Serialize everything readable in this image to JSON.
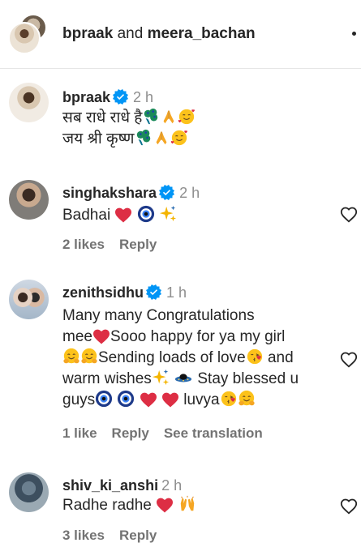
{
  "header": {
    "title_user1": "bpraak",
    "title_and": " and ",
    "title_user2": "meera_bachan"
  },
  "caption": {
    "username": "bpraak",
    "time": "2 h",
    "line1": "सब राधे राधे है",
    "line2": "जय श्री कृष्ण"
  },
  "comments": [
    {
      "username": "singhakshara",
      "time": "2 h",
      "text1": "Badhai",
      "likes": "2 likes",
      "reply": "Reply"
    },
    {
      "username": "zenithsidhu",
      "time": "1 h",
      "text1": "Many many Congratulations",
      "text2a": "mee",
      "text2b": "Sooo happy for ya my girl",
      "text3a": "Sending loads of love",
      "text3b": " and",
      "text4a": "warm wishes",
      "text4b": " Stay blessed u",
      "text5a": "guys",
      "text5b": " luvya",
      "likes": "1 like",
      "reply": "Reply",
      "translate": "See translation"
    },
    {
      "username": "shiv_ki_anshi",
      "time": "2 h",
      "text1": "Radhe radhe",
      "likes": "3 likes",
      "reply": "Reply"
    }
  ],
  "colors": {
    "verified": "#0095f6",
    "heart_emoji": "#e0245e",
    "meta": "#737373"
  }
}
